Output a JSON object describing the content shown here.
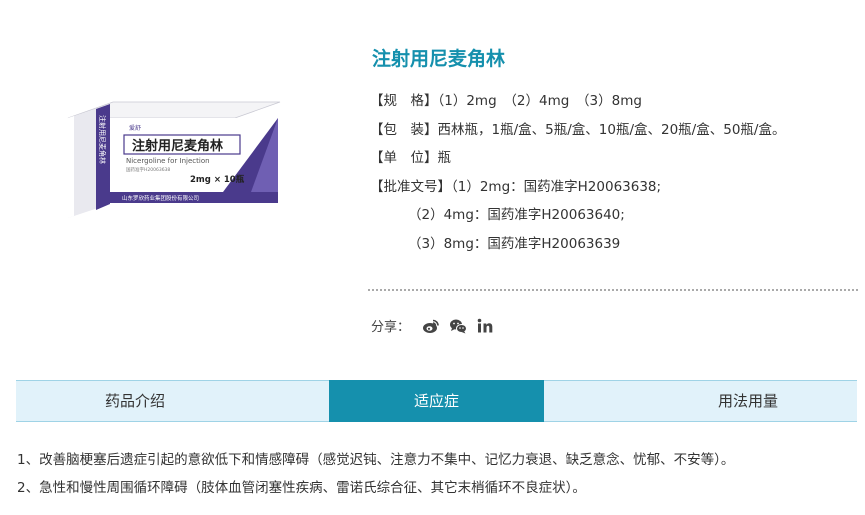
{
  "product": {
    "title": "注射用尼麦角林",
    "box": {
      "brand": "爱舒",
      "name": "注射用尼麦角林",
      "side_name": "注射用尼麦角林",
      "latin": "Nicergoline for Injection",
      "spec": "2mg × 10瓶",
      "approval": "国药准字H20063638",
      "manufacturer": "山东罗欣药业集团股份有限公司"
    }
  },
  "specs": {
    "rows": [
      "【规　格】（1）2mg　（2）4mg　（3）8mg",
      "【包　装】西林瓶，1瓶/盒、5瓶/盒、10瓶/盒、20瓶/盒、50瓶/盒。",
      "【单　位】瓶",
      "【批准文号】（1）2mg：国药准字H20063638;"
    ],
    "approval_extra": [
      "（2）4mg：国药准字H20063640;",
      "（3）8mg：国药准字H20063639"
    ]
  },
  "share": {
    "label": "分享：",
    "icons": [
      "weibo-icon",
      "wechat-icon",
      "linkedin-icon"
    ]
  },
  "tabs": [
    {
      "label": "药品介绍",
      "active": false
    },
    {
      "label": "适应症",
      "active": true
    },
    {
      "label": "用法用量",
      "active": false
    }
  ],
  "indications": [
    "1、改善脑梗塞后遗症引起的意欲低下和情感障碍（感觉迟钝、注意力不集中、记忆力衰退、缺乏意念、忧郁、不安等）。",
    "2、急性和慢性周围循环障碍（肢体血管闭塞性疾病、雷诺氏综合征、其它末梢循环不良症状）。"
  ],
  "colors": {
    "accent": "#1590ad",
    "tab_bg": "#e1f2fa",
    "box_purple": "#4a3a8c"
  }
}
